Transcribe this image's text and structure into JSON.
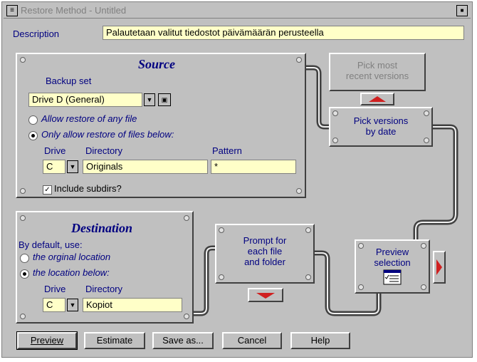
{
  "window": {
    "title": "Restore Method - Untitled"
  },
  "description": {
    "label": "Description",
    "value": "Palautetaan valitut tiedostot päivämäärän perusteella"
  },
  "source": {
    "title": "Source",
    "backup_set_label": "Backup set",
    "backup_set_value": "Drive D (General)",
    "option_any": "Allow restore of any file",
    "option_below": "Only allow restore of files below:",
    "selected_option": "below",
    "drive_label": "Drive",
    "directory_label": "Directory",
    "pattern_label": "Pattern",
    "drive_value": "C",
    "directory_value": "Originals",
    "pattern_value": "*",
    "include_subdirs_label": "Include subdirs?",
    "include_subdirs_checked": true
  },
  "destination": {
    "title": "Destination",
    "by_default_label": "By default, use:",
    "option_original": "the orginal location",
    "option_below": "the location below:",
    "selected_option": "below",
    "drive_label": "Drive",
    "directory_label": "Directory",
    "drive_value": "C",
    "directory_value": "Kopiot"
  },
  "nodes": {
    "pick_recent": {
      "line1": "Pick most",
      "line2": "recent versions",
      "enabled": false
    },
    "pick_by_date": {
      "line1": "Pick versions",
      "line2": "by date",
      "enabled": true
    },
    "prompt": {
      "line1": "Prompt for",
      "line2": "each file",
      "line3": "and folder"
    },
    "preview": {
      "line1": "Preview",
      "line2": "selection"
    }
  },
  "buttons": {
    "preview": "Preview",
    "estimate": "Estimate",
    "save_as": "Save as...",
    "cancel": "Cancel",
    "help": "Help"
  },
  "colors": {
    "accent_arrow": "#d02020",
    "label_blue": "#000080",
    "field_yellow": "#ffffc8"
  }
}
